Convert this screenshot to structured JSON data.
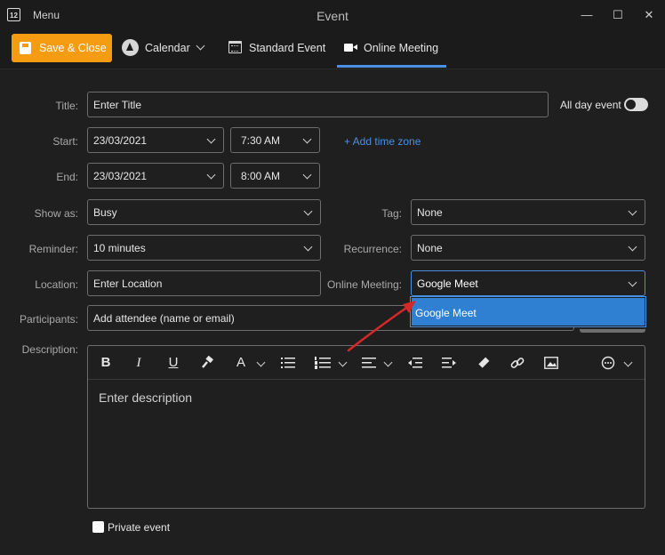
{
  "window": {
    "calendar_icon_text": "12",
    "menu_label": "Menu",
    "title": "Event",
    "minimize": "—",
    "maximize": "☐",
    "close": "✕"
  },
  "toolbar": {
    "save_label": "Save & Close",
    "calendar_label": "Calendar",
    "standard_event_label": "Standard Event",
    "online_meeting_label": "Online Meeting",
    "accent_color": "#f59c12",
    "active_tab_color": "#4a90e2"
  },
  "form": {
    "title_label": "Title:",
    "title_placeholder": "Enter Title",
    "all_day_label": "All day event",
    "start_label": "Start:",
    "start_date": "23/03/2021",
    "start_time": "7:30 AM",
    "add_time_zone": "+ Add time zone",
    "end_label": "End:",
    "end_date": "23/03/2021",
    "end_time": "8:00 AM",
    "show_as_label": "Show as:",
    "show_as_value": "Busy",
    "tag_label": "Tag:",
    "tag_value": "None",
    "reminder_label": "Reminder:",
    "reminder_value": "10 minutes",
    "recurrence_label": "Recurrence:",
    "recurrence_value": "None",
    "location_label": "Location:",
    "location_placeholder": "Enter Location",
    "online_meeting_label": "Online Meeting:",
    "online_meeting_value": "Google Meet",
    "online_meeting_options": [
      "Google Meet"
    ],
    "participants_label": "Participants:",
    "participants_placeholder": "Add attendee (name or email)",
    "description_label": "Description:",
    "description_placeholder": "Enter description",
    "private_label": "Private event"
  },
  "editor_toolbar": {
    "bold": "B",
    "italic": "I",
    "underline": "U",
    "font_color": "A"
  }
}
